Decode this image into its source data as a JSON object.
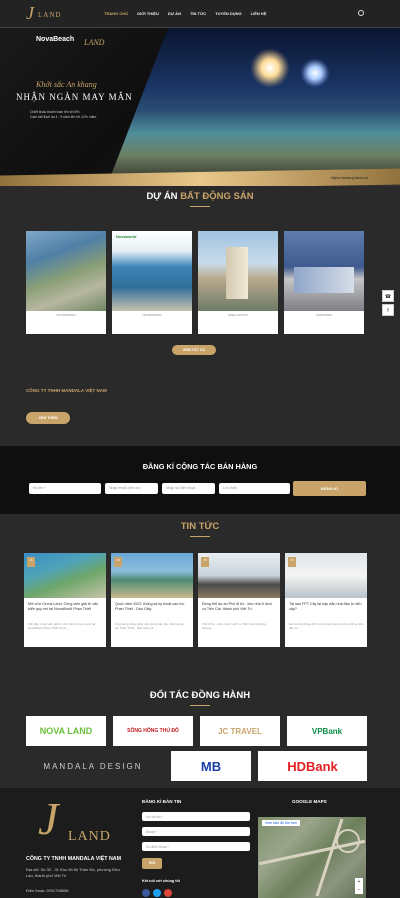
{
  "header": {
    "logo": "LAND",
    "nav": [
      "TRANG CHỦ",
      "GIỚI THIỆU",
      "DỰ ÁN",
      "TIN TỨC",
      "TUYỂN DỤNG",
      "LIÊN HỆ"
    ]
  },
  "banner": {
    "brand": "NovaBeach",
    "brand2": "LAND",
    "line1": "Khởi sắc An khang",
    "line2": "NHẬN NGÀN MAY MẮN",
    "line3": "Chiết khấu thanh toán lên tới 8%",
    "line4": "Cam kết thuê lại 4 - 9 năm lên tới 12% /năm",
    "site": "https://www.jcland.vn"
  },
  "projects": {
    "title_prefix": "DỰ ÁN",
    "title_suffix": "BẤT ĐỘNG SẢN",
    "items": [
      {
        "caption": "NOVAWORLD"
      },
      {
        "caption": "NOVAWORLD"
      },
      {
        "caption": "APEC GROUP"
      },
      {
        "caption": "VINHOMES"
      }
    ],
    "more_label": "XEM TẤT CẢ",
    "banner_tag": "Novaworld"
  },
  "about": {
    "company": "CÔNG TY TNHH MANDALA VIỆT NAM",
    "more_label": "XEM THÊM"
  },
  "register": {
    "title": "ĐĂNG KÍ CỘNG TÁC BÁN HÀNG",
    "fields": [
      {
        "placeholder": "Họ tên *"
      },
      {
        "placeholder": "Nhập email (nếu có)"
      },
      {
        "placeholder": "Nhập số điện thoại"
      },
      {
        "placeholder": "Lời nhắn"
      }
    ],
    "submit": "ĐĂNG KÍ"
  },
  "news": {
    "title": "TIN TỨC",
    "items": [
      {
        "date": "15",
        "title": "Mở cửa Circus Land: Công viên giải trí văn biển quy mô tại NovaWorld Phan Thiết",
        "desc": "Mới đây, công viên giải trí văn biển Circus Land tại NovaWorld Phan Thiết chính..."
      },
      {
        "date": "15",
        "title": "Quốc năm 2022: thông sạ kỳ thuật cao tốc Phan Thiết - Dầu Giây",
        "desc": "Ứng dụng công nghệ xây dựng hiện đại, đường cao tốc Phan Thiết - Dầu Giây sẽ..."
      },
      {
        "date": "15",
        "title": "Động thổ dự án Phố đi bộ - khu nhà ở dịch vụ Tiến Cát, thành phố Việt Trì",
        "desc": "Phố đi bộ – khu nhà ở dịch vụ Tiến Cát là không thoáng..."
      },
      {
        "date": "15",
        "title": "Tại sao FPT City lại hấp dẫn nhà đầu tư đến vậy?",
        "desc": "Để hướng đúng đích trường và chương của những nhà đầu tư..."
      }
    ]
  },
  "partners": {
    "title": "ĐỐI TÁC ĐỒNG HÀNH",
    "items": [
      {
        "name": "NOVA LAND",
        "color": "#6bbf3a"
      },
      {
        "name": "SÔNG HỒNG THỦ ĐÔ",
        "color": "#c2161b"
      },
      {
        "name": "JC TRAVEL",
        "color": "#c9a46a"
      },
      {
        "name": "VPBank",
        "color": "#0a8b43"
      },
      {
        "name": "MANDALA DESIGN",
        "color": "#cccccc"
      },
      {
        "name": "MB",
        "color": "#1a3ea6"
      },
      {
        "name": "HDBank",
        "color": "#e31e24"
      }
    ]
  },
  "footer": {
    "logo": "LAND",
    "company": "CÔNG TY TNHH MANDALA VIỆT NAM",
    "address": "Địa chỉ: Số 30 - 31 Khu đô thị Trầm Đà, phường Dữu Lâu, thành phố Việt Trì",
    "phone": "Điện thoại: 0931798558",
    "newsletter_title": "ĐĂNG KÍ BẢN TIN",
    "name_ph": "Họ và tên *",
    "email_ph": "Email *",
    "phone_ph": "Số điện thoại *",
    "send": "GỬI",
    "social_title": "Kết nối với chúng tôi",
    "map_title": "GOOGLE MAPS",
    "map_link": "Xem bản đồ lớn hơn"
  }
}
